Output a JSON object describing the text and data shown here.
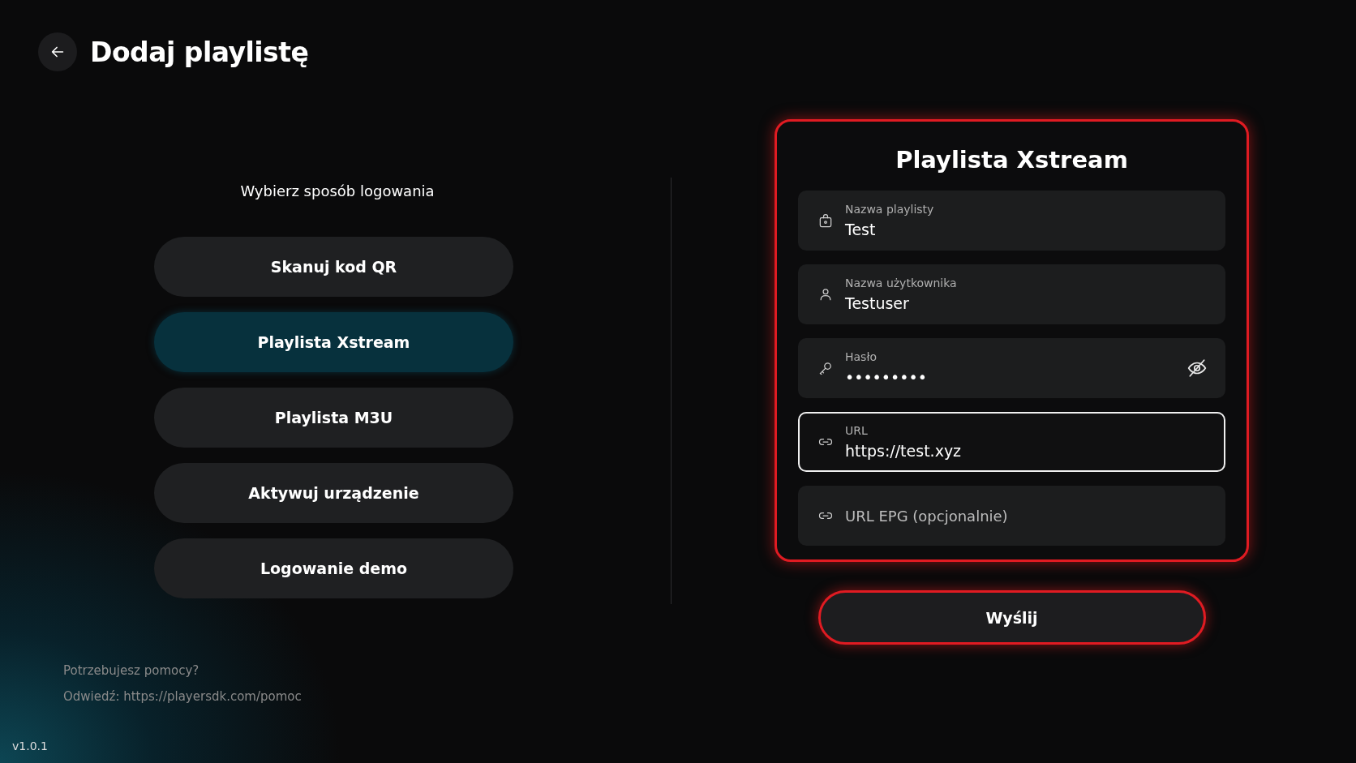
{
  "header": {
    "title": "Dodaj playlistę"
  },
  "login_methods": {
    "heading": "Wybierz sposób logowania",
    "options": [
      {
        "label": "Skanuj kod QR",
        "selected": false
      },
      {
        "label": "Playlista Xstream",
        "selected": true
      },
      {
        "label": "Playlista M3U",
        "selected": false
      },
      {
        "label": "Aktywuj urządzenie",
        "selected": false
      },
      {
        "label": "Logowanie demo",
        "selected": false
      }
    ]
  },
  "form": {
    "title": "Playlista Xstream",
    "fields": [
      {
        "kind": "playlist",
        "label": "Nazwa playlisty",
        "value": "Test",
        "focused": false
      },
      {
        "kind": "user",
        "label": "Nazwa użytkownika",
        "value": "Testuser",
        "focused": false
      },
      {
        "kind": "password",
        "label": "Hasło",
        "value": "•••••••••",
        "focused": false
      },
      {
        "kind": "link",
        "label": "URL",
        "value": "https://test.xyz",
        "focused": true
      },
      {
        "kind": "link",
        "placeholder": "URL EPG (opcjonalnie)",
        "focused": false
      }
    ],
    "submit": "Wyślij"
  },
  "help": [
    "Potrzebujesz pomocy?",
    "Odwiedź: https://playersdk.com/pomoc"
  ],
  "version": "v1.0.1"
}
